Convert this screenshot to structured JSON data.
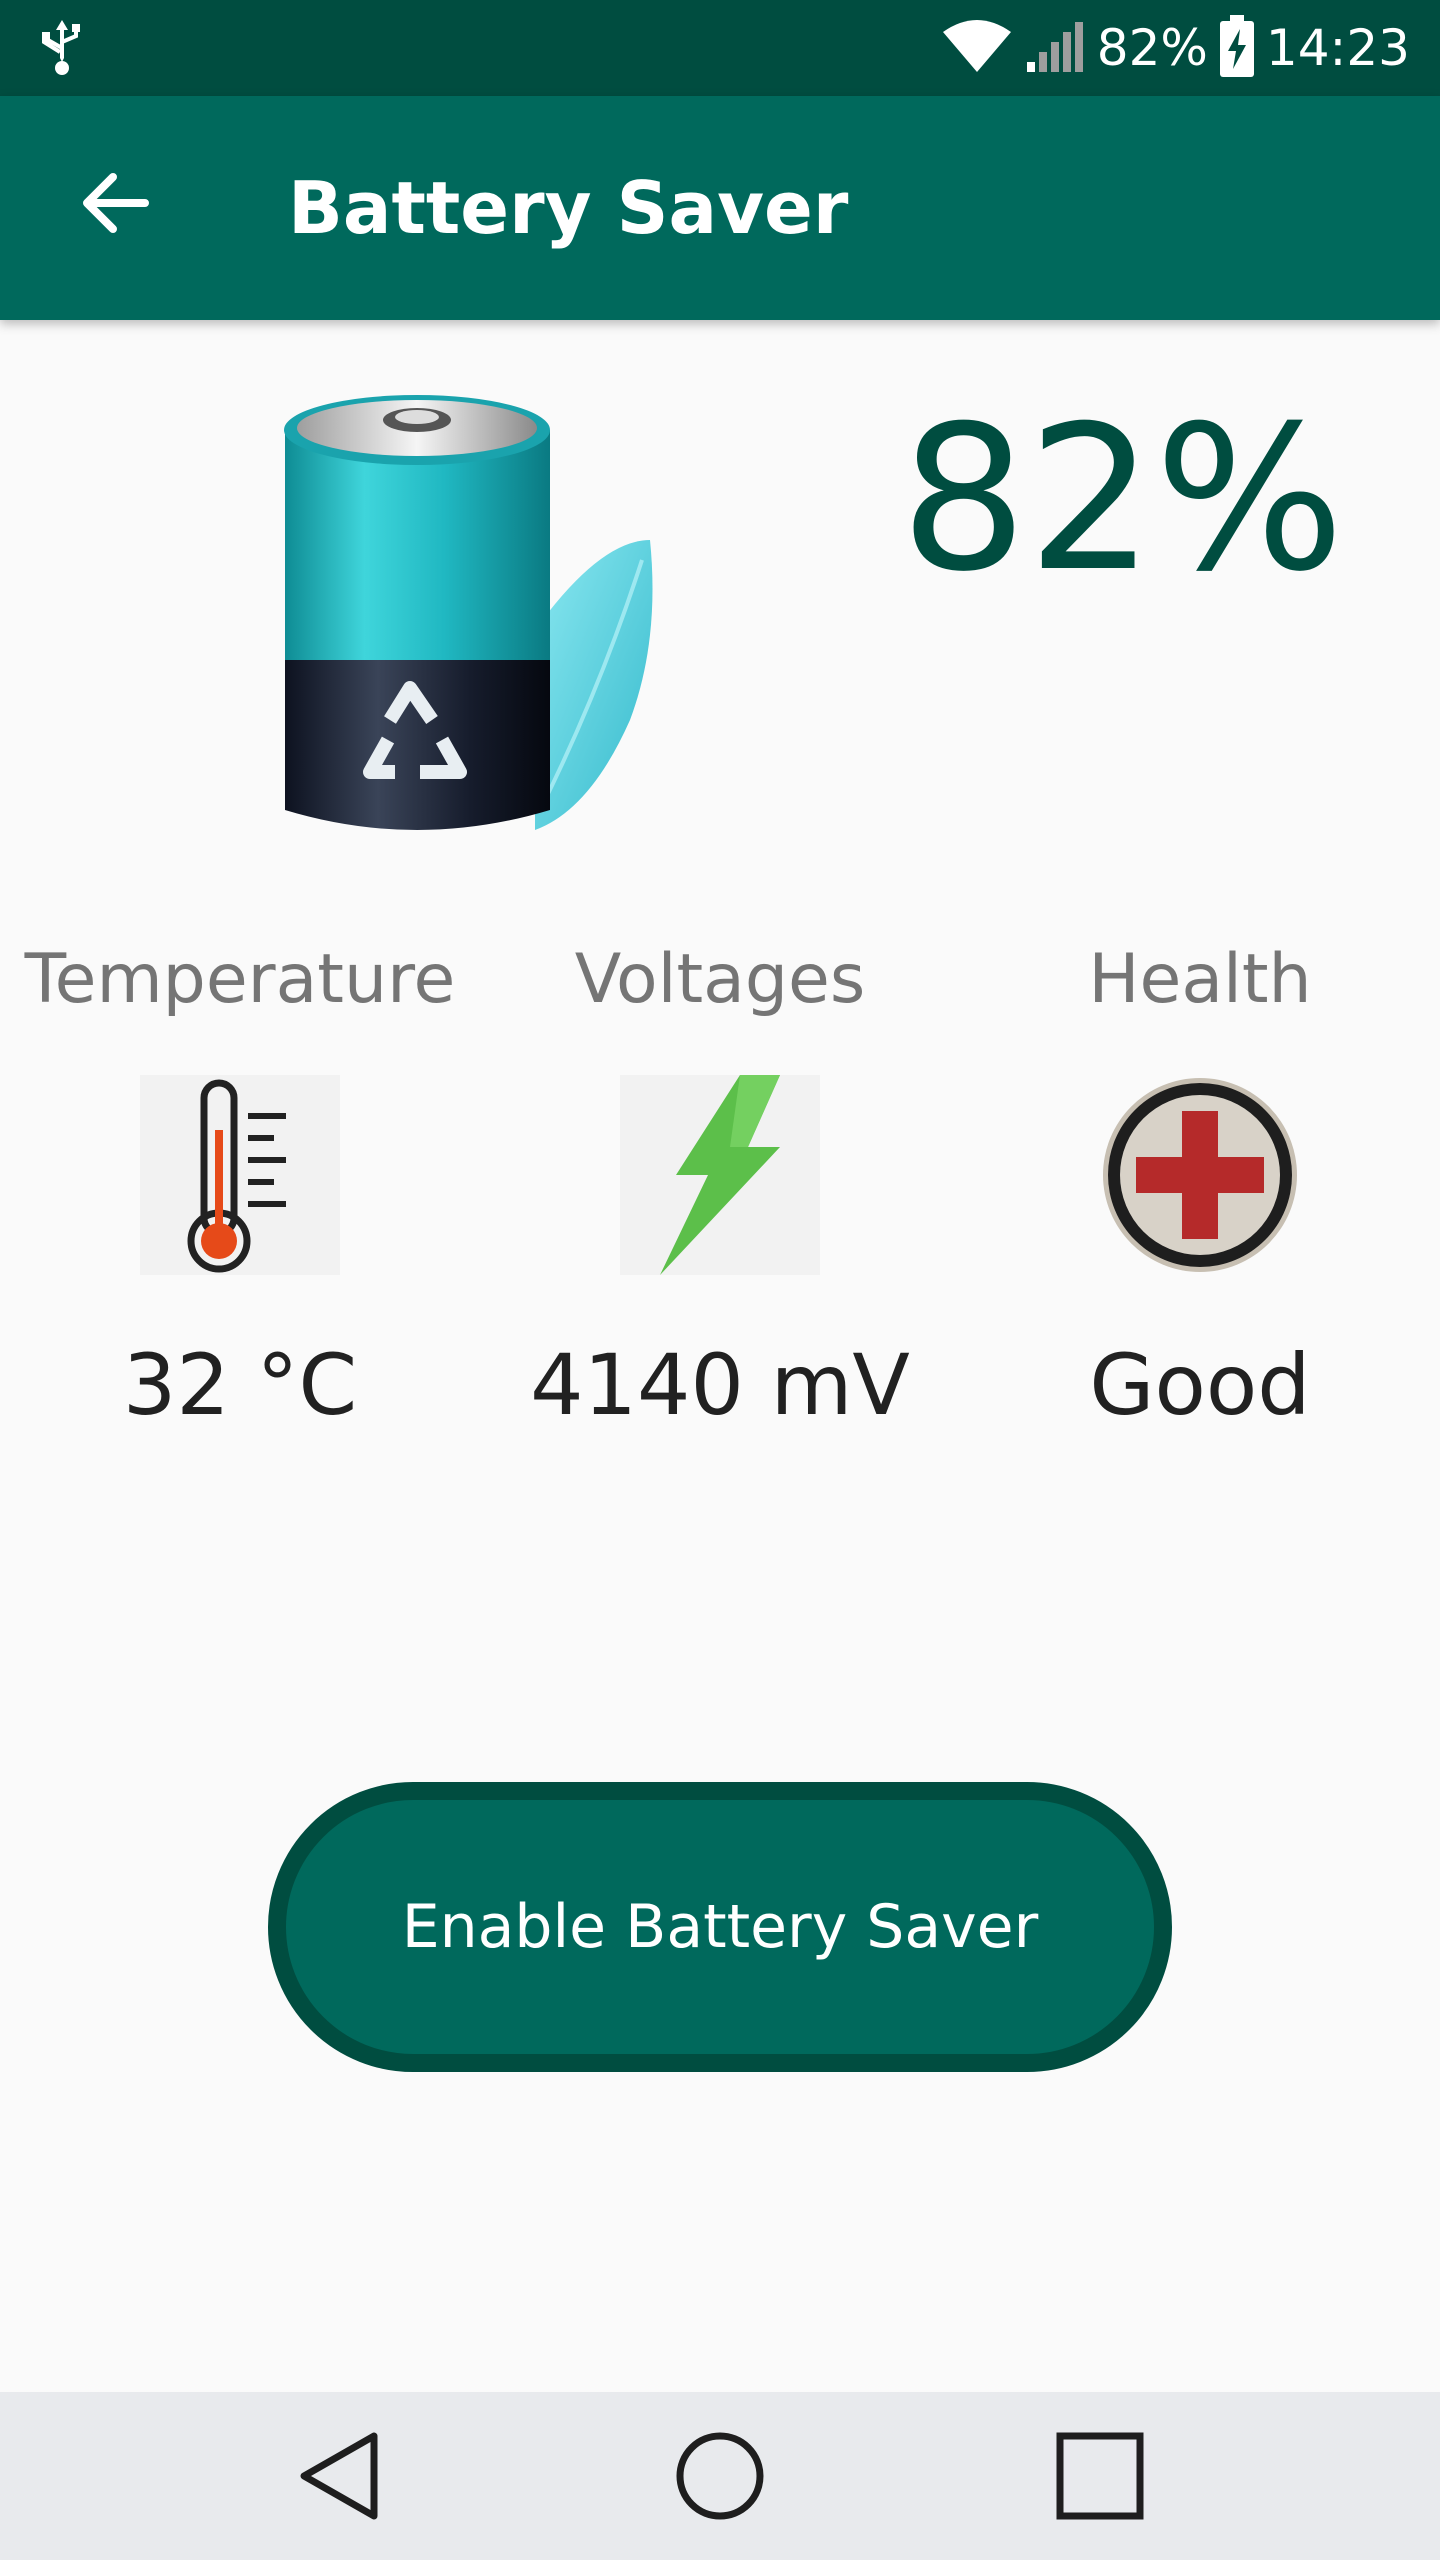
{
  "status_bar": {
    "battery_percent": "82%",
    "time": "14:23",
    "icons": [
      "usb-icon",
      "wifi-icon",
      "signal-icon",
      "battery-charging-icon"
    ]
  },
  "app_bar": {
    "title": "Battery Saver",
    "back_icon": "arrow-back-icon"
  },
  "battery": {
    "percent": "82%",
    "image_icon": "battery-recycle-icon"
  },
  "stats": [
    {
      "label": "Temperature",
      "value": "32 °C",
      "icon": "thermometer-icon"
    },
    {
      "label": "Voltages",
      "value": "4140 mV",
      "icon": "lightning-icon"
    },
    {
      "label": "Health",
      "value": "Good",
      "icon": "red-cross-icon"
    }
  ],
  "enable_button": {
    "label": "Enable Battery Saver"
  },
  "nav_bar": {
    "icons": [
      "nav-back-icon",
      "nav-home-icon",
      "nav-recents-icon"
    ]
  },
  "colors": {
    "status_bar": "#004d40",
    "app_bar": "#00695c",
    "accent_dark": "#004d40",
    "background": "#fafafa",
    "label_gray": "#757575"
  }
}
